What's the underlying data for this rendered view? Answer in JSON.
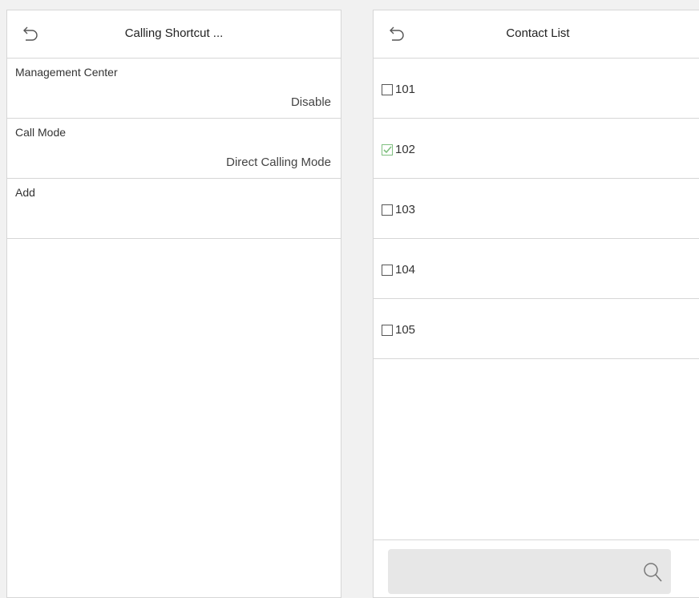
{
  "left_screen": {
    "title": "Calling Shortcut ...",
    "items": [
      {
        "label": "Management Center",
        "value": "Disable"
      },
      {
        "label": "Call Mode",
        "value": "Direct Calling Mode"
      },
      {
        "label": "Add",
        "value": ""
      }
    ]
  },
  "right_screen": {
    "title": "Contact List",
    "contacts": [
      {
        "number": "101",
        "checked": false
      },
      {
        "number": "102",
        "checked": true
      },
      {
        "number": "103",
        "checked": false
      },
      {
        "number": "104",
        "checked": false
      },
      {
        "number": "105",
        "checked": false
      }
    ],
    "search": {
      "value": ""
    }
  },
  "icons": {
    "back": "back-arrow-icon",
    "search": "search-icon",
    "check": "check-icon"
  },
  "colors": {
    "check_accent": "#7fbf7f",
    "divider": "#d6d6d6",
    "search_bg": "#e7e7e7"
  }
}
